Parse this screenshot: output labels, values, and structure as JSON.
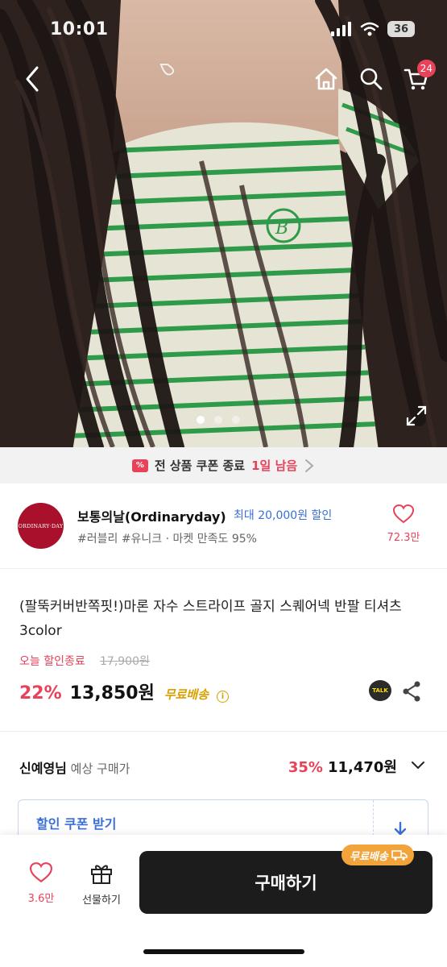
{
  "status_bar": {
    "time": "10:01",
    "battery": "36"
  },
  "header": {
    "cart_count": "24"
  },
  "gallery": {
    "dots": 3,
    "active_index": 0
  },
  "coupon_banner": {
    "text": "전 상품 쿠폰 종료",
    "remaining": "1일 남음"
  },
  "seller": {
    "logo_text": "ORDINARY·DAY",
    "name": "보통의날(Ordinaryday)",
    "coupon": "최대 20,000원 할인",
    "tags": "#러블리 #유니크 · 마켓 만족도 95%",
    "likes": "72.3만"
  },
  "product": {
    "title": "(팔뚝커버반쪽핏!)마론 자수 스트라이프 골지 스퀘어넥 반팔 티셔츠 3color",
    "discount_label": "오늘 할인종료",
    "original_price": "17,900원",
    "discount_rate": "22%",
    "price": "13,850원",
    "shipping": "무료배송",
    "talk_label": "TALK"
  },
  "member": {
    "name": "신예영님",
    "sub": " 예상 구매가",
    "rate": "35%",
    "price": "11,470원"
  },
  "coupon_box": {
    "label": "할인 쿠폰 받기"
  },
  "bottom_bar": {
    "likes": "3.6만",
    "gift_label": "선물하기",
    "buy_label": "구매하기",
    "buy_badge": "무료배송"
  },
  "colors": {
    "accent_red": "#e8425a",
    "link_blue": "#3a6fd8",
    "ship_gold": "#d9a000",
    "stripe_green": "#2f9a4a"
  }
}
